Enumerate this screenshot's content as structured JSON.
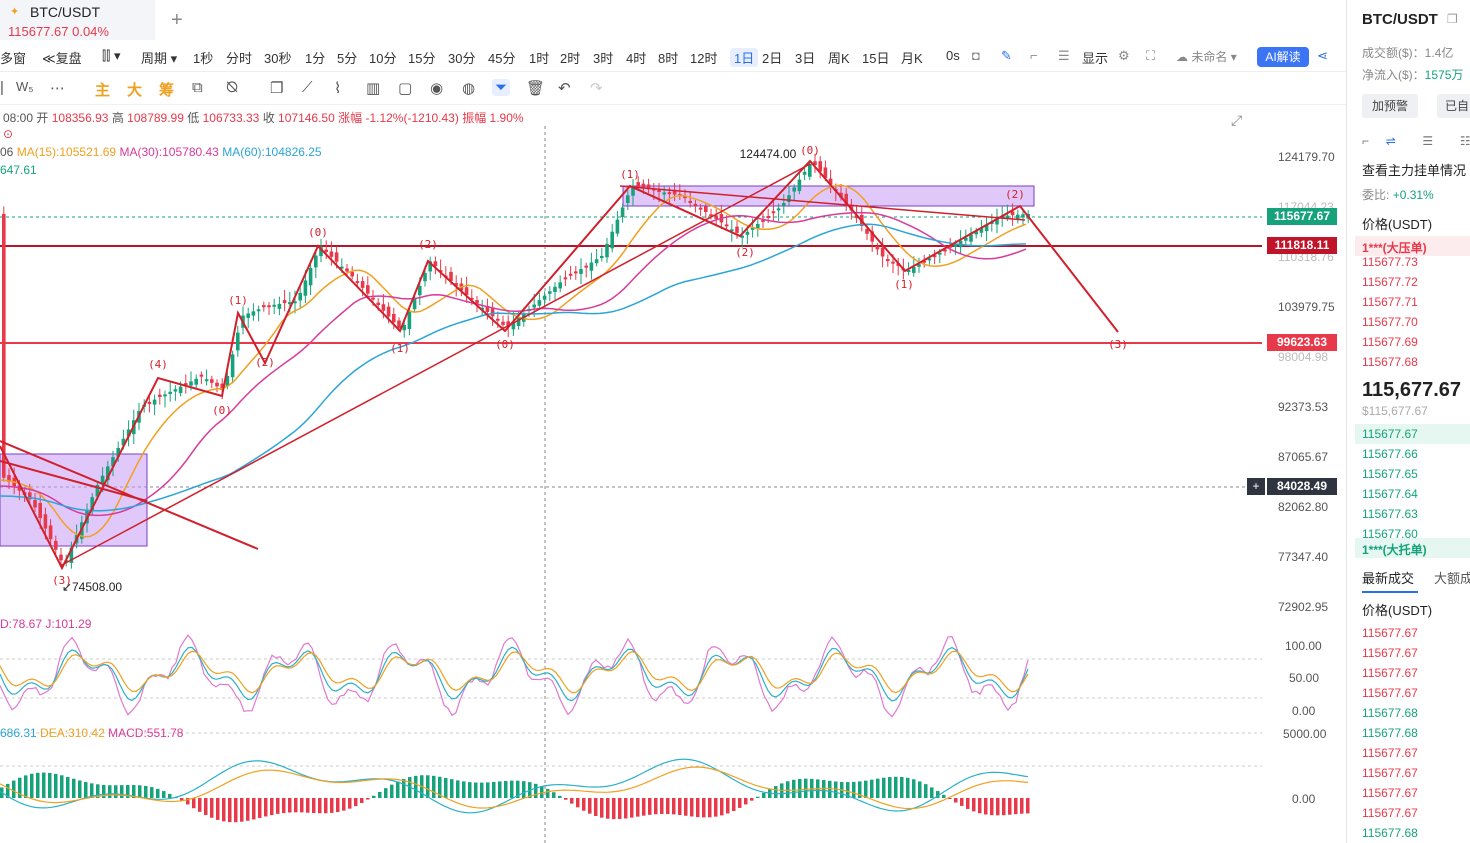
{
  "tab": {
    "symbol": "BTC/USDT",
    "price_change": "115677.67 0.04%",
    "star": "✦",
    "add": "+"
  },
  "toolbar1": {
    "multi": "多窗",
    "replay": "复盘",
    "period": "周期",
    "intervals": [
      "1秒",
      "分时",
      "30秒",
      "1分",
      "5分",
      "10分",
      "15分",
      "30分",
      "45分",
      "1时",
      "2时",
      "3时",
      "4时",
      "8时",
      "12时",
      "1日",
      "2日",
      "3日",
      "周K",
      "15日",
      "月K"
    ],
    "active_interval": "1日",
    "zero_s": "0s",
    "display": "显示",
    "unnamed": "未命名",
    "ai": "AI解读"
  },
  "toolbar2": {
    "main": "主",
    "big": "大",
    "chip": "筹"
  },
  "ohlc": {
    "time": "08:00",
    "open_label": "开",
    "open": "108356.93",
    "high_label": "高",
    "high": "108789.99",
    "low_label": "低",
    "low": "106733.33",
    "close_label": "收",
    "close": "107146.50",
    "change": "涨幅 -1.12%(-1210.43)",
    "amp": "振幅 1.90%"
  },
  "ma": {
    "prefix": "06",
    "ma15": "MA(15):105521.69",
    "ma30": "MA(30):105780.43",
    "ma60": "MA(60):104826.25",
    "sub": "647.61"
  },
  "kdj": {
    "d": "D:78.67",
    "j": "J:101.29"
  },
  "macd": {
    "dif": "686.31",
    "dea": "DEA:310.42",
    "macd": "MACD:551.78"
  },
  "chart_labels": {
    "high_mark": "124474.00",
    "low_mark": "74508.00",
    "wave_labels": [
      "(1)",
      "(2)",
      "(3)",
      "(4)",
      "(0)",
      "(1)",
      "(2)",
      "(0)",
      "(1)",
      "(2)",
      "(0)",
      "(1)",
      "(2)",
      "(0)",
      "(1)",
      "(2)",
      "(3)"
    ]
  },
  "y_axis": [
    "124179.70",
    "117044.23",
    "110318.76",
    "103979.75",
    "98004.98",
    "92373.53",
    "87065.67",
    "82062.80",
    "77347.40",
    "72902.95"
  ],
  "indicator_axis": {
    "kdj": [
      "100.00",
      "50.00",
      "0.00"
    ],
    "macd": [
      "5000.00",
      "0.00"
    ]
  },
  "price_tags": {
    "current": "115677.67",
    "resistance": "111818.11",
    "support": "99623.63",
    "crosshair": "84028.49"
  },
  "colors": {
    "up": "#16a37b",
    "down": "#e8394a",
    "ma15": "#f0a020",
    "ma30": "#d83b9a",
    "ma60": "#2ba5d8",
    "zone": "#c89af5",
    "wave": "#d0202c"
  },
  "panel": {
    "title": "BTC/USDT",
    "turnover": "成交额($)：1.4亿",
    "netflow_label": "净流入($)：",
    "netflow": "1575万",
    "alert_btn": "加预警",
    "done_btn": "已自",
    "orderbook_title": "查看主力挂单情况",
    "ratio_label": "委比:",
    "ratio": "+0.31%",
    "price_header": "价格(USDT)",
    "big_ask": "1***(大压单)",
    "asks": [
      "115677.73",
      "115677.72",
      "115677.71",
      "115677.70",
      "115677.69",
      "115677.68"
    ],
    "last_price": "115,677.67",
    "last_usd": "$115,677.67",
    "bids": [
      "115677.67",
      "115677.66",
      "115677.65",
      "115677.64",
      "115677.63",
      "115677.60"
    ],
    "big_bid": "1***(大托单)",
    "trades_tab": "最新成交",
    "big_trades_tab": "大额成",
    "trades_header": "价格(USDT)",
    "trades": [
      {
        "p": "115677.67",
        "side": "sell"
      },
      {
        "p": "115677.67",
        "side": "sell"
      },
      {
        "p": "115677.67",
        "side": "sell"
      },
      {
        "p": "115677.67",
        "side": "sell"
      },
      {
        "p": "115677.68",
        "side": "buy"
      },
      {
        "p": "115677.68",
        "side": "buy"
      },
      {
        "p": "115677.67",
        "side": "sell"
      },
      {
        "p": "115677.67",
        "side": "sell"
      },
      {
        "p": "115677.67",
        "side": "sell"
      },
      {
        "p": "115677.67",
        "side": "sell"
      },
      {
        "p": "115677.68",
        "side": "buy"
      }
    ]
  }
}
